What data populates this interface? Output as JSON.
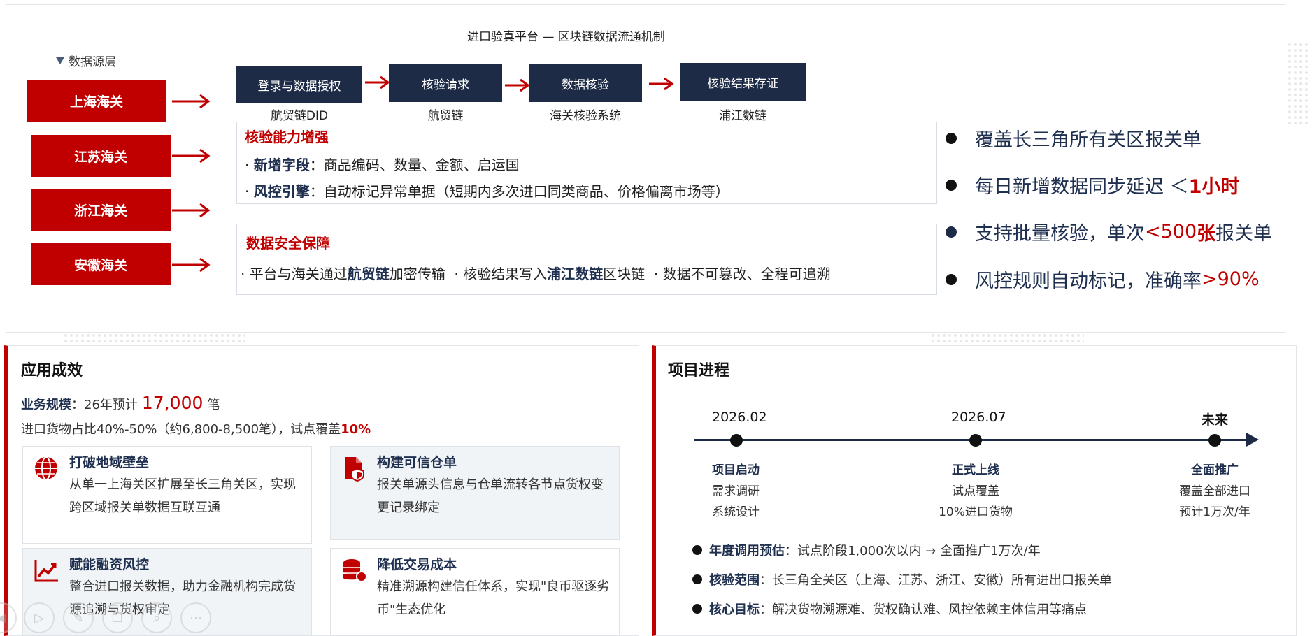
{
  "top": {
    "title": "进口验真平台 — 区块链数据流通机制",
    "source_layer_label": "数据源层",
    "customs": [
      "上海海关",
      "江苏海关",
      "浙江海关",
      "安徽海关"
    ],
    "flow": [
      {
        "label": "登录与数据授权",
        "caption": "航贸链DID"
      },
      {
        "label": "核验请求",
        "caption": "航贸链"
      },
      {
        "label": "数据核验",
        "caption": "海关核验系统"
      },
      {
        "label": "核验结果存证",
        "caption": "浦江数链"
      }
    ],
    "capability": {
      "title": "核验能力增强",
      "line1_bold": "新增字段",
      "line1_text": "：商品编码、数量、金额、启运国",
      "line2_bold": "风控引擎",
      "line2_text": "：自动标记异常单据（短期内多次进口同类商品、价格偏离市场等）"
    },
    "security": {
      "title": "数据安全保障",
      "p1_pre": "平台与海关通过",
      "p1_bold": "航贸链",
      "p1_post": "加密传输",
      "p2_pre": "核验结果写入",
      "p2_bold": "浦江数链",
      "p2_post": "区块链",
      "p3": "数据不可篡改、全程可追溯"
    },
    "bullets": {
      "b1": "覆盖长三角所有关区报关单",
      "b2_pre": "每日新增数据同步延迟 ＜ ",
      "b2_hl": "1小时",
      "b3_pre": "支持批量核验，单次",
      "b3_hl1": "<500",
      "b3_hl2": "张",
      "b3_post": "报关单",
      "b4_pre": "风控规则自动标记，准确率",
      "b4_hl": ">90%"
    }
  },
  "effect": {
    "title": "应用成效",
    "scale_label": "业务规模",
    "scale_mid": "：26年预计",
    "scale_value": "17,000",
    "scale_unit": "笔",
    "share_text": "进口货物占比40%-50%（约6,800-8,500笔），试点覆盖",
    "share_hl": "10%",
    "cards": [
      {
        "title": "打破地域壁垒",
        "desc": "从单一上海关区扩展至长三角关区，实现跨区域报关单数据互联互通"
      },
      {
        "title": "构建可信仓单",
        "desc": "报关单源头信息与仓单流转各节点货权变更记录绑定"
      },
      {
        "title": "赋能融资风控",
        "desc": "整合进口报关数据，助力金融机构完成货源追溯与货权审定"
      },
      {
        "title": "降低交易成本",
        "desc": "精准溯源构建信任体系，实现\"良币驱逐劣币\"生态优化"
      }
    ]
  },
  "progress": {
    "title": "项目进程",
    "milestones": [
      {
        "date": "2026.02",
        "title": "项目启动",
        "l1": "需求调研",
        "l2": "系统设计"
      },
      {
        "date": "2026.07",
        "title": "正式上线",
        "l1": "试点覆盖",
        "l2": "10%进口货物"
      },
      {
        "date": "未来",
        "title": "全面推广",
        "l1": "覆盖全部进口",
        "l2": "预计1万次/年"
      }
    ],
    "points": [
      {
        "bold": "年度调用预估",
        "text": "：试点阶段1,000次以内 → 全面推广1万次/年"
      },
      {
        "bold": "核验范围",
        "text": "：长三角全关区（上海、江苏、浙江、安徽）所有进出口报关单"
      },
      {
        "bold": "核心目标",
        "text": "：解决货物溯源难、货权确认难、风控依赖主体信用等痛点"
      }
    ]
  },
  "colors": {
    "accent_red": "#c00000",
    "navy": "#1e2b46"
  }
}
